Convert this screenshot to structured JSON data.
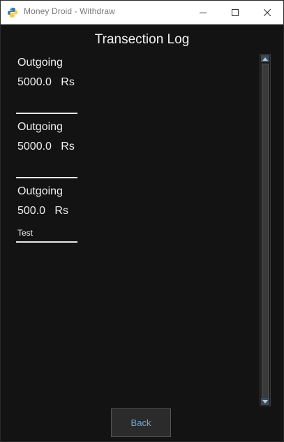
{
  "window": {
    "title": "Money Droid - Withdraw"
  },
  "screen": {
    "heading": "Transection Log"
  },
  "entries": [
    {
      "type": "Outgoing",
      "amount": "5000.0",
      "currency": "Rs",
      "note": ""
    },
    {
      "type": "Outgoing",
      "amount": "5000.0",
      "currency": "Rs",
      "note": ""
    },
    {
      "type": "Outgoing",
      "amount": "500.0",
      "currency": "Rs",
      "note": "Test"
    }
  ],
  "buttons": {
    "back": "Back"
  },
  "icons": {
    "app": "python-icon",
    "minimize": "minimize-icon",
    "maximize": "maximize-icon",
    "close": "close-icon"
  },
  "colors": {
    "background": "#131313",
    "text": "#efefef",
    "accent": "#6fa6d9"
  }
}
